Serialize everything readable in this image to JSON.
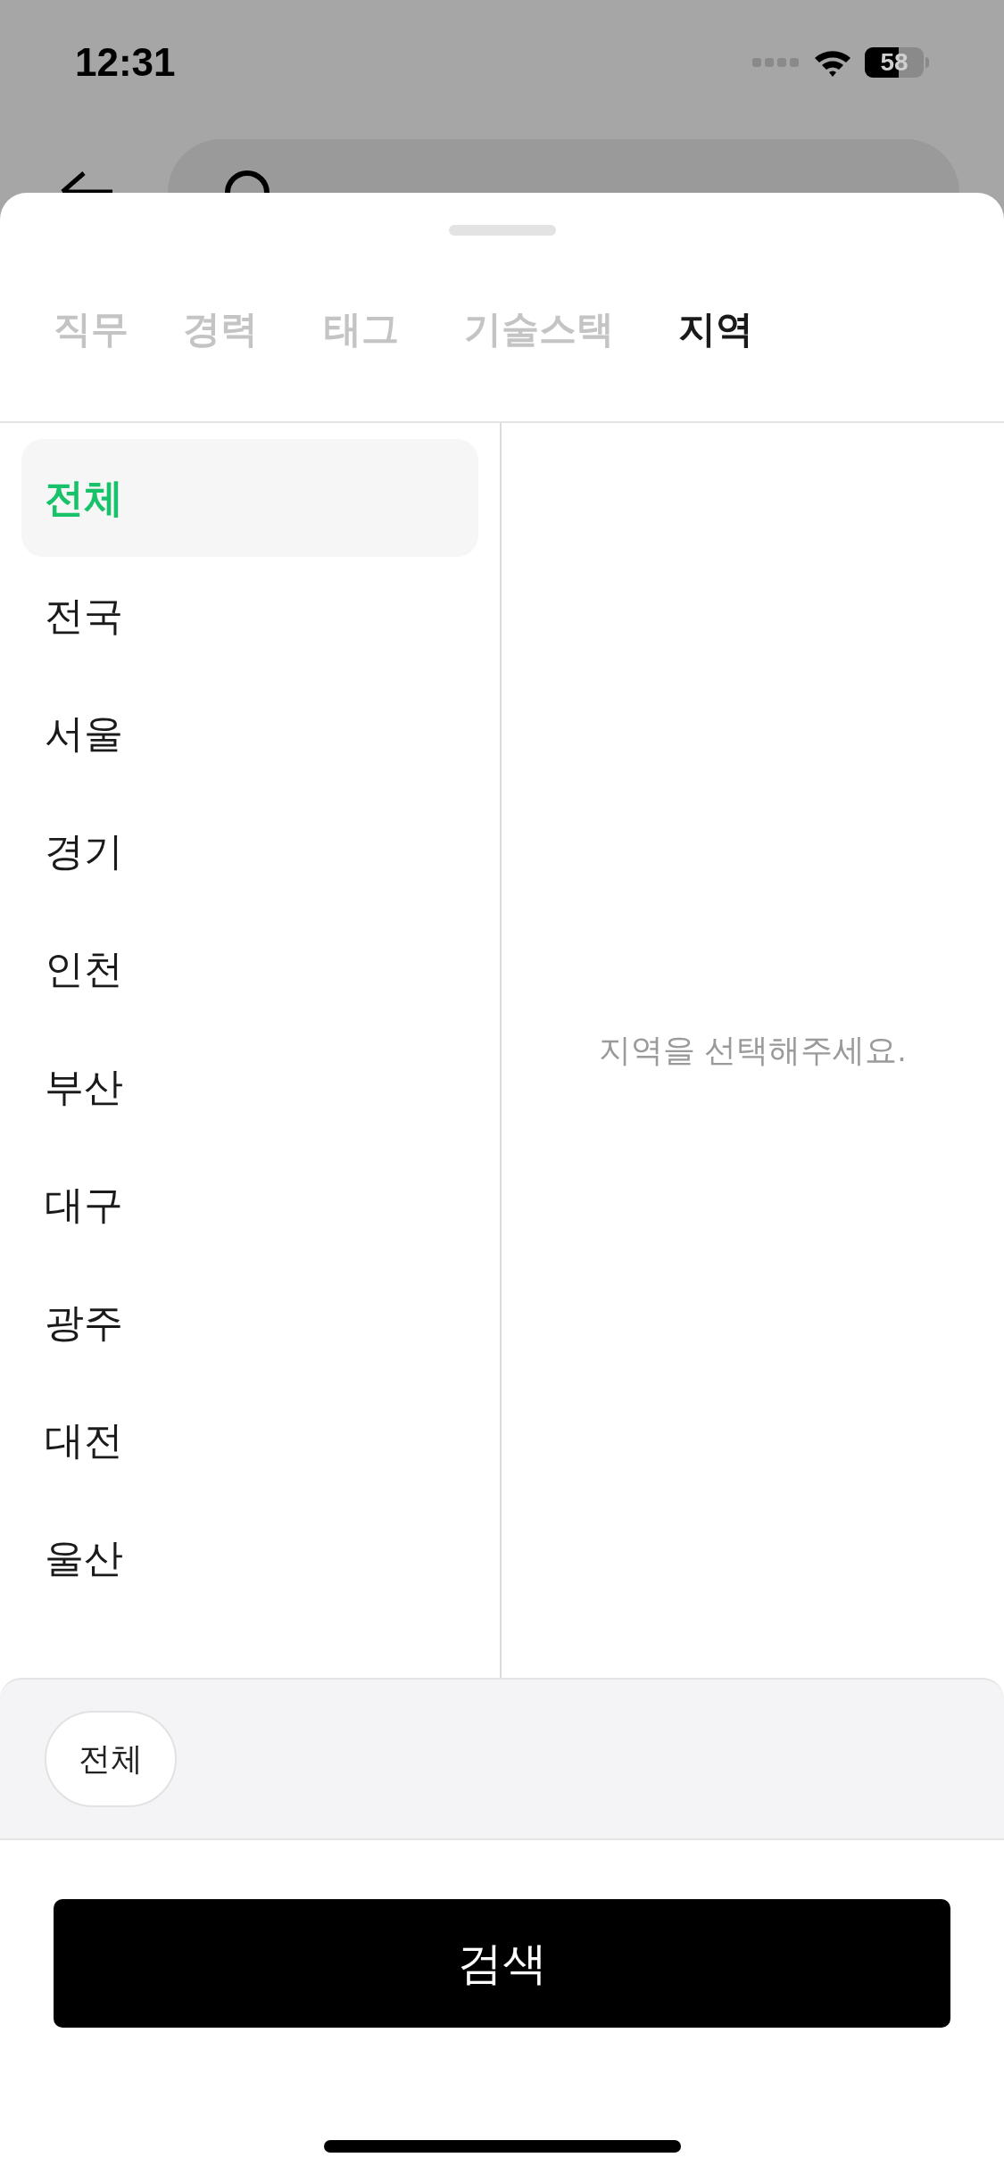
{
  "status_bar": {
    "time": "12:31",
    "battery": "58"
  },
  "tabs": [
    {
      "label": "직무",
      "selected": false
    },
    {
      "label": "경력",
      "selected": false
    },
    {
      "label": "태그",
      "selected": false
    },
    {
      "label": "기술스택",
      "selected": false
    },
    {
      "label": "지역",
      "selected": true
    }
  ],
  "regions": [
    {
      "label": "전체",
      "selected": true
    },
    {
      "label": "전국",
      "selected": false
    },
    {
      "label": "서울",
      "selected": false
    },
    {
      "label": "경기",
      "selected": false
    },
    {
      "label": "인천",
      "selected": false
    },
    {
      "label": "부산",
      "selected": false
    },
    {
      "label": "대구",
      "selected": false
    },
    {
      "label": "광주",
      "selected": false
    },
    {
      "label": "대전",
      "selected": false
    },
    {
      "label": "울산",
      "selected": false
    }
  ],
  "detail_placeholder": "지역을 선택해주세요.",
  "chips": [
    "전체"
  ],
  "search_button": "검색"
}
